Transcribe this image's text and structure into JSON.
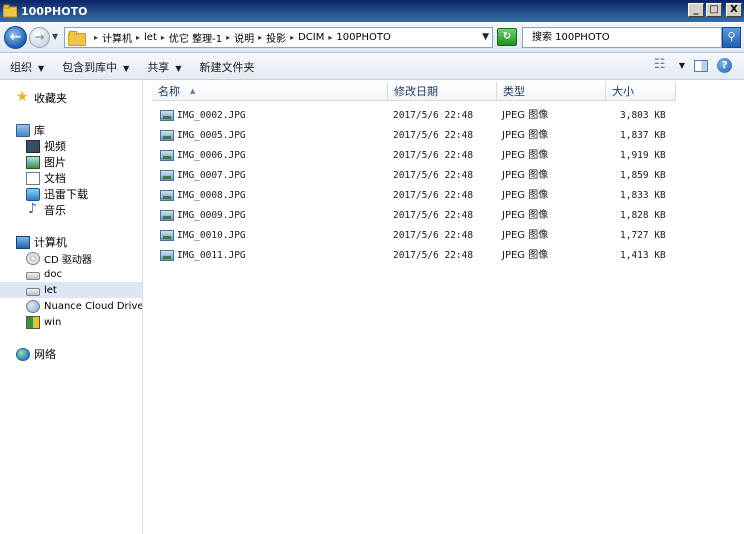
{
  "window": {
    "title": "100PHOTO",
    "minimize": "_",
    "maximize": "□",
    "close": "X"
  },
  "address": {
    "crumbs": [
      "计算机",
      "let",
      "优它 整理-1",
      "说明",
      "投影",
      "DCIM",
      "100PHOTO"
    ],
    "search_placeholder": "搜索 100PHOTO"
  },
  "toolbar": {
    "organize": "组织",
    "include_in_library": "包含到库中",
    "share": "共享",
    "new_folder": "新建文件夹"
  },
  "sidebar": {
    "favorites": "收藏夹",
    "libraries": "库",
    "library_items": [
      "视频",
      "图片",
      "文档",
      "迅雷下载",
      "音乐"
    ],
    "computer": "计算机",
    "drives": [
      "CD 驱动器",
      "doc",
      "let",
      "Nuance Cloud Drive",
      "win"
    ],
    "network": "网络",
    "selected": "let"
  },
  "columns": {
    "name": "名称",
    "modified": "修改日期",
    "type": "类型",
    "size": "大小"
  },
  "files": [
    {
      "name": "IMG_0002.JPG",
      "modified": "2017/5/6 22:48",
      "type": "JPEG 图像",
      "size": "3,803 KB"
    },
    {
      "name": "IMG_0005.JPG",
      "modified": "2017/5/6 22:48",
      "type": "JPEG 图像",
      "size": "1,837 KB"
    },
    {
      "name": "IMG_0006.JPG",
      "modified": "2017/5/6 22:48",
      "type": "JPEG 图像",
      "size": "1,919 KB"
    },
    {
      "name": "IMG_0007.JPG",
      "modified": "2017/5/6 22:48",
      "type": "JPEG 图像",
      "size": "1,859 KB"
    },
    {
      "name": "IMG_0008.JPG",
      "modified": "2017/5/6 22:48",
      "type": "JPEG 图像",
      "size": "1,833 KB"
    },
    {
      "name": "IMG_0009.JPG",
      "modified": "2017/5/6 22:48",
      "type": "JPEG 图像",
      "size": "1,828 KB"
    },
    {
      "name": "IMG_0010.JPG",
      "modified": "2017/5/6 22:48",
      "type": "JPEG 图像",
      "size": "1,727 KB"
    },
    {
      "name": "IMG_0011.JPG",
      "modified": "2017/5/6 22:48",
      "type": "JPEG 图像",
      "size": "1,413 KB"
    }
  ]
}
